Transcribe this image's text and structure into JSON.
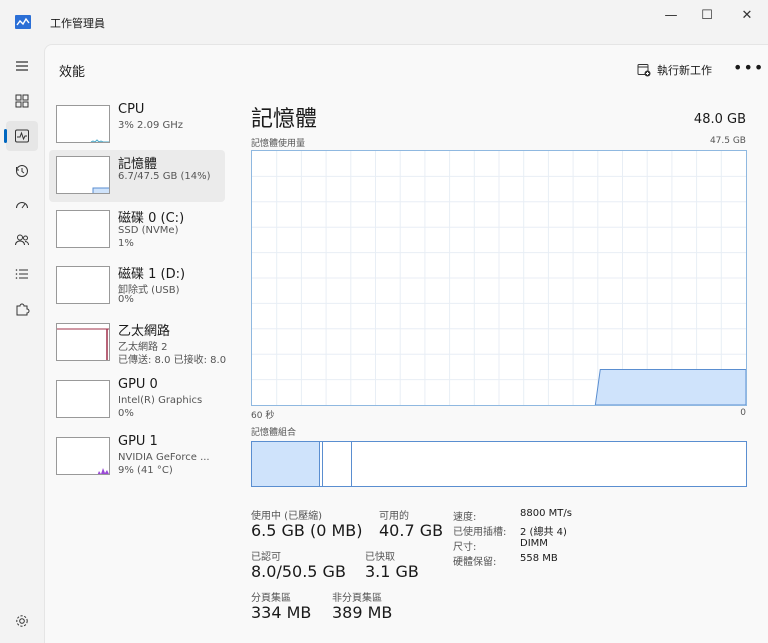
{
  "window": {
    "title": "工作管理員",
    "controls": {
      "minimize": "—",
      "maximize": "☐",
      "close": "✕"
    }
  },
  "nav": {
    "items": [
      {
        "name": "hamburger-menu",
        "icon": "menu-icon"
      },
      {
        "name": "processes",
        "icon": "grid-icon"
      },
      {
        "name": "performance",
        "icon": "performance-icon",
        "active": true
      },
      {
        "name": "app-history",
        "icon": "history-icon"
      },
      {
        "name": "startup-apps",
        "icon": "gauge-icon"
      },
      {
        "name": "users",
        "icon": "users-icon"
      },
      {
        "name": "details",
        "icon": "list-icon"
      },
      {
        "name": "services",
        "icon": "puzzle-icon"
      },
      {
        "name": "settings",
        "icon": "gear-icon"
      }
    ]
  },
  "header": {
    "title": "效能",
    "run_new_task": "執行新工作",
    "more": "•••"
  },
  "resources": [
    {
      "name": "CPU",
      "line1": "3% 2.09 GHz",
      "line2": ""
    },
    {
      "name": "記憶體",
      "line1": "6.7/47.5 GB (14%)",
      "line2": "",
      "selected": true
    },
    {
      "name": "磁碟 0 (C:)",
      "line1": "SSD (NVMe)",
      "line2": "1%"
    },
    {
      "name": "磁碟 1 (D:)",
      "line1": "卸除式 (USB)",
      "line2": "0%"
    },
    {
      "name": "乙太網路",
      "line1": "乙太網路 2",
      "line2": "已傳送: 8.0 已接收: 8.0"
    },
    {
      "name": "GPU 0",
      "line1": "Intel(R) Graphics",
      "line2": "0%"
    },
    {
      "name": "GPU 1",
      "line1": "NVIDIA GeForce ...",
      "line2": "9% (41 °C)"
    }
  ],
  "memory": {
    "title": "記憶體",
    "total": "48.0 GB",
    "usage_label": "記憶體使用量",
    "usage_max": "47.5 GB",
    "axis_left": "60 秒",
    "axis_right": "0",
    "usage_fraction": 0.14,
    "composition_label": "記憶體組合",
    "stats": {
      "in_use_label": "使用中 (已壓縮)",
      "in_use_value": "6.5 GB (0 MB)",
      "available_label": "可用的",
      "available_value": "40.7 GB",
      "committed_label": "已認可",
      "committed_value": "8.0/50.5 GB",
      "cached_label": "已快取",
      "cached_value": "3.1 GB",
      "paged_label": "分頁集區",
      "paged_value": "334 MB",
      "nonpaged_label": "非分頁集區",
      "nonpaged_value": "389 MB"
    },
    "details": [
      {
        "key": "速度:",
        "value": "8800 MT/s"
      },
      {
        "key": "已使用插槽:",
        "value": "2 (總共 4)"
      },
      {
        "key": "尺寸:",
        "value": "DIMM"
      },
      {
        "key": "硬體保留:",
        "value": "558 MB"
      }
    ]
  },
  "colors": {
    "accent": "#0067c0",
    "memory_fill": "#cfe3fb",
    "memory_line": "#5a8ed0",
    "network_line": "#a0304a",
    "gpu_fill": "#9a4ad6",
    "cpu_line": "#4aa8c8"
  }
}
